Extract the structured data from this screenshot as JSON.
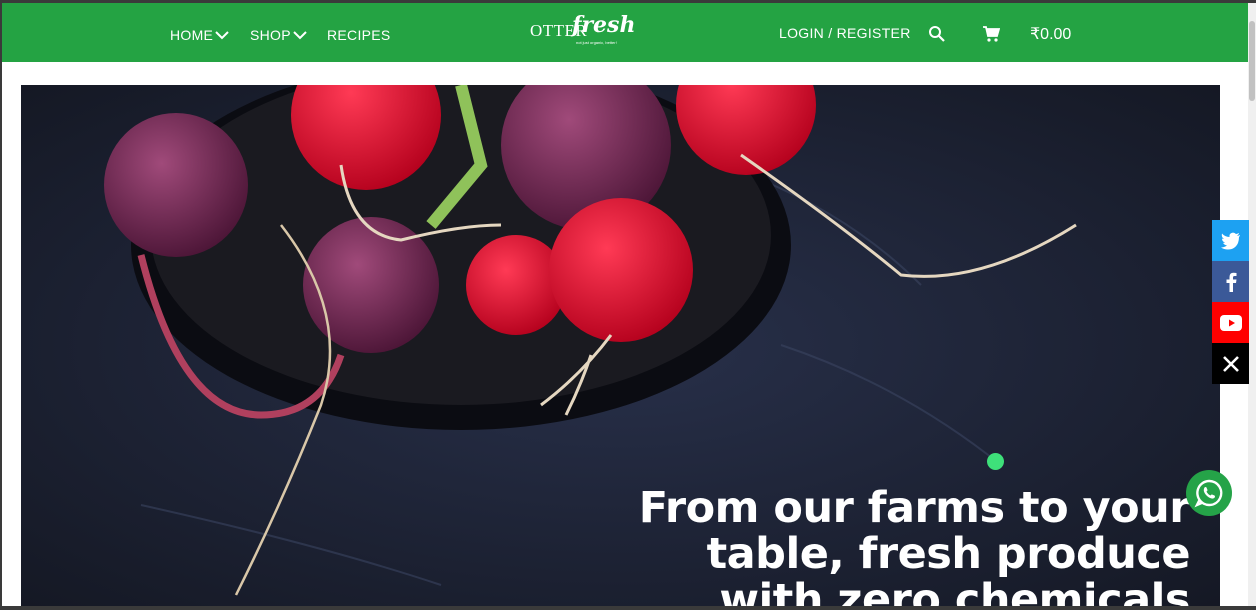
{
  "header": {
    "nav": [
      {
        "label": "HOME",
        "has_dropdown": true
      },
      {
        "label": "SHOP",
        "has_dropdown": true
      },
      {
        "label": "RECIPES",
        "has_dropdown": false
      }
    ],
    "logo": {
      "otter": "OTTER",
      "fresh": "fresh",
      "tagline": "not just organic, better!"
    },
    "login_label": "LOGIN / REGISTER",
    "cart_total": "₹0.00",
    "search_icon": "search-icon",
    "cart_icon": "cart-icon"
  },
  "hero": {
    "headline": "From our farms to your table, fresh produce with zero chemicals"
  },
  "social": [
    {
      "name": "twitter",
      "icon": "twitter-icon",
      "color": "#1da1f2"
    },
    {
      "name": "facebook",
      "icon": "facebook-icon",
      "color": "#3b5998"
    },
    {
      "name": "youtube",
      "icon": "youtube-icon",
      "color": "#ff0000"
    },
    {
      "name": "x",
      "icon": "x-icon",
      "color": "#000000"
    }
  ],
  "whatsapp": {
    "icon": "whatsapp-icon",
    "color": "#25a348"
  },
  "colors": {
    "brand_green": "#24a343",
    "slider_dot": "#3ee07a"
  }
}
